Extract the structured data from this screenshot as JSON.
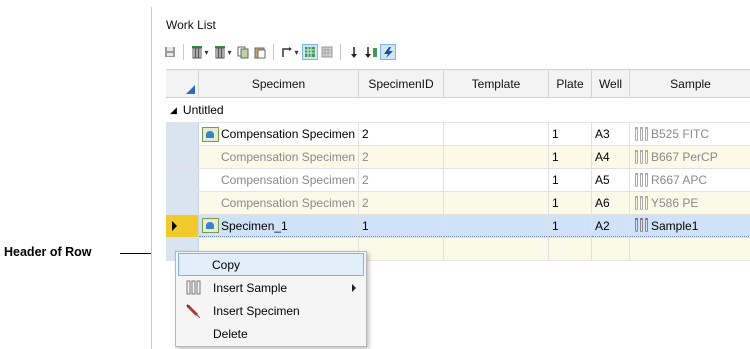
{
  "callout": {
    "label": "Header of Row"
  },
  "window": {
    "title": "Work List"
  },
  "toolbar": {
    "icons": [
      "save-icon",
      "insert-specimen-icon",
      "insert-tube-icon",
      "copy-icon",
      "paste-icon",
      "move-icon",
      "grid-view-icon",
      "table-view-icon",
      "sort-down-icon",
      "sort-up-icon",
      "lightning-icon"
    ]
  },
  "columns": [
    "Specimen",
    "SpecimenID",
    "Template",
    "Plate",
    "Well",
    "Sample"
  ],
  "group": {
    "label": "Untitled"
  },
  "rows": [
    {
      "specimen": "Compensation Specimen",
      "id": "2",
      "template": "",
      "plate": "1",
      "well": "A3",
      "sample": "B525 FITC"
    },
    {
      "specimen": "Compensation Specimen",
      "id": "2",
      "template": "",
      "plate": "1",
      "well": "A4",
      "sample": "B667 PerCP"
    },
    {
      "specimen": "Compensation Specimen",
      "id": "2",
      "template": "",
      "plate": "1",
      "well": "A5",
      "sample": "R667 APC"
    },
    {
      "specimen": "Compensation Specimen",
      "id": "2",
      "template": "",
      "plate": "1",
      "well": "A6",
      "sample": "Y586 PE"
    },
    {
      "specimen": "Specimen_1",
      "id": "1",
      "template": "",
      "plate": "1",
      "well": "A2",
      "sample": "Sample1"
    }
  ],
  "context_menu": {
    "items": [
      {
        "label": "Copy"
      },
      {
        "label": "Insert Sample"
      },
      {
        "label": "Insert Specimen"
      },
      {
        "label": "Delete"
      }
    ]
  },
  "colors": {
    "selection": "#cfe2f7",
    "row_header_selected": "#f0c92a",
    "alt_row": "#fbf9e8",
    "accent": "#2a6cc4"
  }
}
